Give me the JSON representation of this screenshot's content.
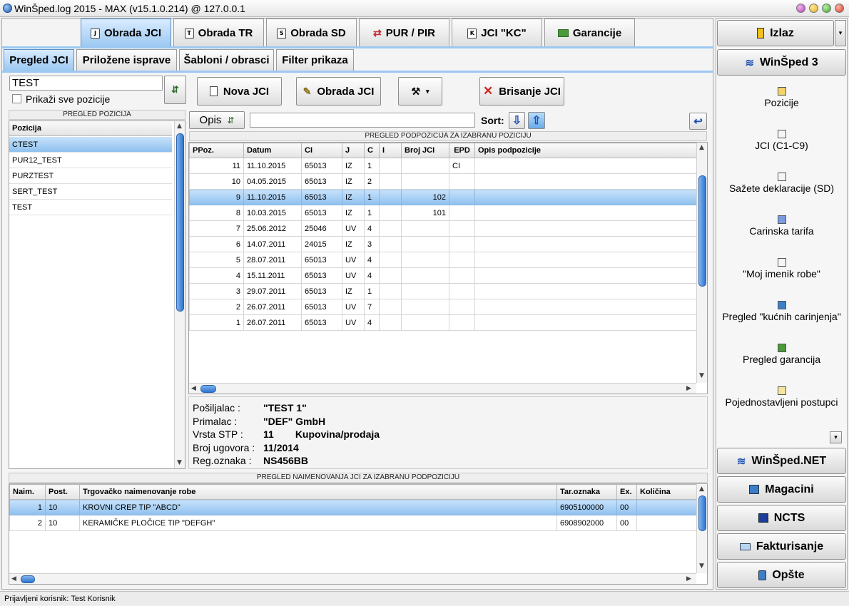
{
  "window": {
    "title": "WinŠped.log 2015 - MAX (v15.1.0.214) @ 127.0.0.1",
    "icons": [
      "app-icon",
      "minimize-icon",
      "restore-icon",
      "close-icon"
    ]
  },
  "main_tabs": [
    {
      "label": "Obrada JCI",
      "icon": "document-jci-icon"
    },
    {
      "label": "Obrada TR",
      "icon": "document-tr-icon"
    },
    {
      "label": "Obrada SD",
      "icon": "document-sd-icon"
    },
    {
      "label": "PUR / PIR",
      "icon": "swap-arrows-icon"
    },
    {
      "label": "JCI \"KC\"",
      "icon": "document-kc-icon"
    },
    {
      "label": "Garancije",
      "icon": "money-icon"
    }
  ],
  "sub_tabs": [
    "Pregled JCI",
    "Priložene isprave",
    "Šabloni / obrasci",
    "Filter prikaza"
  ],
  "filter": {
    "search_value": "TEST",
    "show_all_label": "Prikaži sve pozicije"
  },
  "toolbar": {
    "new_label": "Nova JCI",
    "edit_label": "Obrada JCI",
    "delete_label": "Brisanje JCI"
  },
  "positions": {
    "caption": "PREGLED POZICIJA",
    "header": "Pozicija",
    "items": [
      "CTEST",
      "PUR12_TEST",
      "PURZTEST",
      "SERT_TEST",
      "TEST"
    ]
  },
  "subpos_bar": {
    "opis_label": "Opis",
    "sort_label": "Sort:"
  },
  "subpositions": {
    "caption": "PREGLED PODPOZICIJA ZA IZABRANU POZICIJU",
    "headers": [
      "PPoz.",
      "Datum",
      "CI",
      "J",
      "C",
      "I",
      "Broj JCI",
      "EPD",
      "Opis podpozicije"
    ],
    "rows": [
      [
        "11",
        "11.10.2015",
        "65013",
        "IZ",
        "1",
        "",
        "",
        "CI",
        ""
      ],
      [
        "10",
        "04.05.2015",
        "65013",
        "IZ",
        "2",
        "",
        "",
        "",
        ""
      ],
      [
        "9",
        "11.10.2015",
        "65013",
        "IZ",
        "1",
        "",
        "102",
        "",
        ""
      ],
      [
        "8",
        "10.03.2015",
        "65013",
        "IZ",
        "1",
        "",
        "101",
        "",
        ""
      ],
      [
        "7",
        "25.06.2012",
        "25046",
        "UV",
        "4",
        "",
        "",
        "",
        ""
      ],
      [
        "6",
        "14.07.2011",
        "24015",
        "IZ",
        "3",
        "",
        "",
        "",
        ""
      ],
      [
        "5",
        "28.07.2011",
        "65013",
        "UV",
        "4",
        "",
        "",
        "",
        ""
      ],
      [
        "4",
        "15.11.2011",
        "65013",
        "UV",
        "4",
        "",
        "",
        "",
        ""
      ],
      [
        "3",
        "29.07.2011",
        "65013",
        "IZ",
        "1",
        "",
        "",
        "",
        ""
      ],
      [
        "2",
        "26.07.2011",
        "65013",
        "UV",
        "7",
        "",
        "",
        "",
        ""
      ],
      [
        "1",
        "26.07.2011",
        "65013",
        "UV",
        "4",
        "",
        "",
        "",
        ""
      ]
    ]
  },
  "details": [
    {
      "label": "Pošiljalac :",
      "value": "\"TEST 1\"",
      "extra": ""
    },
    {
      "label": "Primalac :",
      "value": "\"DEF\" GmbH",
      "extra": ""
    },
    {
      "label": "Vrsta STP :",
      "value": "11",
      "extra": "Kupovina/prodaja"
    },
    {
      "label": "Broj ugovora :",
      "value": "11/2014",
      "extra": ""
    },
    {
      "label": "Reg.oznaka :",
      "value": "NS456BB",
      "extra": ""
    }
  ],
  "goods": {
    "caption": "PREGLED NAIMENOVANJA JCI ZA IZABRANU PODPOZICIJU",
    "headers": [
      "Naim.",
      "Post.",
      "Trgovačko naimenovanje robe",
      "Tar.oznaka",
      "Ex.",
      "Količina"
    ],
    "rows": [
      [
        "1",
        "10",
        "KROVNI CREP TIP \"ABCD\"",
        "6905100000",
        "00",
        ""
      ],
      [
        "2",
        "10",
        "KERAMIČKE PLOČICE TIP \"DEFGH\"",
        "6908902000",
        "00",
        ""
      ]
    ]
  },
  "right_panel": {
    "exit_label": "Izlaz",
    "winsped3_label": "WinŠped 3",
    "items": [
      "Pozicije",
      "JCI (C1-C9)",
      "Sažete deklaracije (SD)",
      "Carinska tarifa",
      "\"Moj imenik robe\"",
      "Pregled \"kućnih carinjenja\"",
      "Pregled garancija",
      "Pojednostavljeni postupci"
    ],
    "modules": [
      "WinŠped.NET",
      "Magacini",
      "NCTS",
      "Fakturisanje",
      "Opšte"
    ]
  },
  "status": {
    "text": "Prijavljeni korisnik: Test Korisnik"
  },
  "colors": {
    "accent": "#9cc8f2",
    "selection": "#8ec0ee",
    "scroll_thumb": "#2e74d0"
  }
}
